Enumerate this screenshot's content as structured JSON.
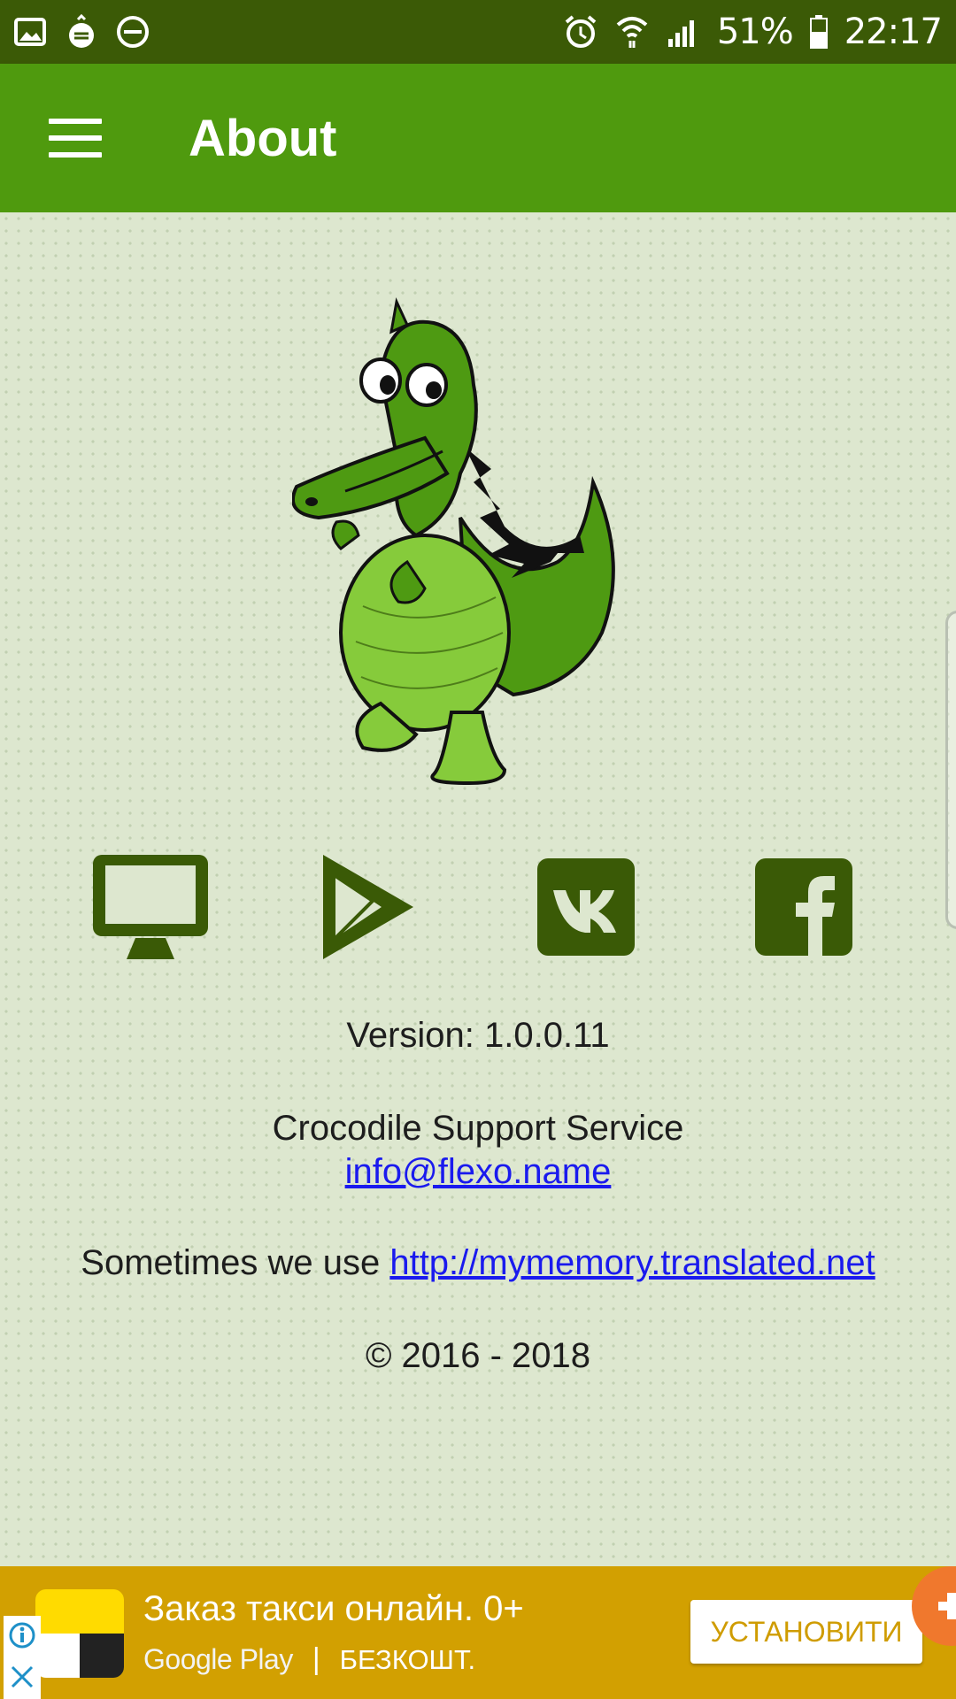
{
  "status_bar": {
    "battery": "51%",
    "time": "22:17",
    "icons_left": [
      "image-icon",
      "app-notification-icon",
      "do-not-disturb-icon"
    ],
    "icons_right": [
      "alarm-icon",
      "wifi-icon",
      "signal-icon",
      "battery-icon"
    ]
  },
  "app_bar": {
    "title": "About"
  },
  "social": {
    "items": [
      "website-icon",
      "google-play-icon",
      "vk-icon",
      "facebook-icon"
    ],
    "color": "#3a5a06"
  },
  "info": {
    "version": "Version: 1.0.0.11",
    "support_label": "Crocodile Support Service",
    "support_email": "info@flexo.name",
    "translate_prefix": "Sometimes we use ",
    "translate_link": "http://mymemory.translated.net",
    "copyright": "© 2016 - 2018"
  },
  "ad": {
    "title": "Заказ такси онлайн. 0+",
    "store": "Google Play",
    "separator": "|",
    "price": "БЕЗКОШТ.",
    "button_label": "УСТАНОВИТИ"
  },
  "colors": {
    "status_bar": "#3b5a06",
    "app_bar": "#4f9a0e",
    "background": "#dde7cf",
    "ad_background": "#d2a001",
    "link": "#1a1aee"
  }
}
